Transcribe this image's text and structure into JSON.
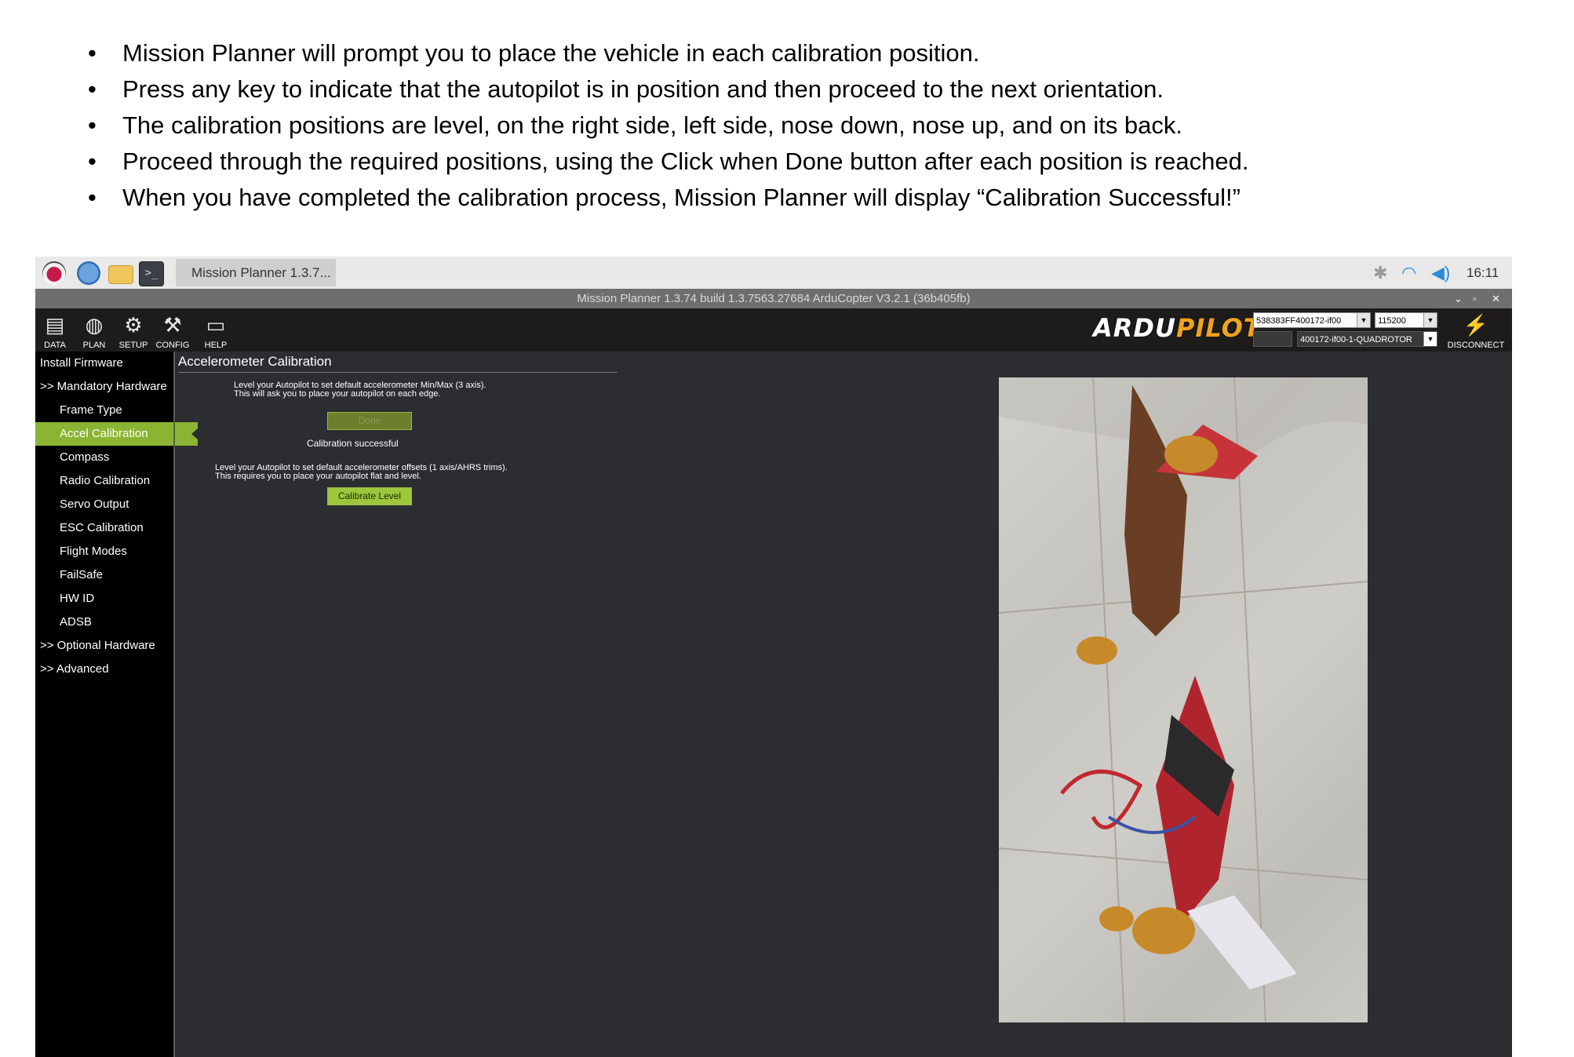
{
  "document": {
    "bullets": [
      "Mission Planner will prompt you to place the vehicle in each calibration position.",
      "Press any key to indicate that the autopilot is in position and then proceed to the next orientation.",
      "The calibration positions are level, on the right side, left side, nose down, nose up, and on its back.",
      "Proceed through the required positions, using the Click when Done button after each position is reached.",
      "When you have completed the calibration process, Mission Planner will display “Calibration Successful!”"
    ]
  },
  "taskbar": {
    "window_button": "Mission Planner 1.3.7...",
    "clock": "16:11",
    "icons": [
      "raspberry-icon",
      "globe-icon",
      "folder-icon",
      "terminal-icon",
      "bluetooth-icon",
      "wifi-icon",
      "volume-icon"
    ],
    "terminal_glyph": ">_"
  },
  "window": {
    "title": "Mission Planner 1.3.74 build 1.3.7563.27684 ArduCopter V3.2.1 (36b405fb)"
  },
  "toolbar": {
    "items": [
      {
        "label": "DATA",
        "icon": "data-icon"
      },
      {
        "label": "PLAN",
        "icon": "plan-icon"
      },
      {
        "label": "SETUP",
        "icon": "setup-icon"
      },
      {
        "label": "CONFIG",
        "icon": "config-icon"
      },
      {
        "label": "HELP",
        "icon": "help-icon"
      }
    ],
    "logo_ardu": "ARDU",
    "logo_pilot": "PILOT",
    "port_value": "538383FF400172-if00",
    "baud_value": "115200",
    "device_value": "400172-if00-1-QUADROTOR",
    "disconnect_label": "DISCONNECT"
  },
  "sidebar": {
    "items": [
      {
        "label": "Install Firmware",
        "level": 0
      },
      {
        "label": ">> Mandatory Hardware",
        "level": 0
      },
      {
        "label": "Frame Type",
        "level": 1
      },
      {
        "label": "Accel Calibration",
        "level": 1,
        "active": true
      },
      {
        "label": "Compass",
        "level": 1
      },
      {
        "label": "Radio Calibration",
        "level": 1
      },
      {
        "label": "Servo Output",
        "level": 1
      },
      {
        "label": "ESC Calibration",
        "level": 1
      },
      {
        "label": "Flight Modes",
        "level": 1
      },
      {
        "label": "FailSafe",
        "level": 1
      },
      {
        "label": "HW ID",
        "level": 1
      },
      {
        "label": "ADSB",
        "level": 1
      },
      {
        "label": ">> Optional Hardware",
        "level": 0
      },
      {
        "label": ">> Advanced",
        "level": 0
      }
    ]
  },
  "main": {
    "title": "Accelerometer Calibration",
    "accel_line1": "Level your Autopilot to set default accelerometer Min/Max (3 axis).",
    "accel_line2": "This will ask you to place your autopilot on each edge.",
    "done_button": "Done",
    "status": "Calibration successful",
    "level_line1": "Level your Autopilot to set default accelerometer offsets (1 axis/AHRS trims).",
    "level_line2": "This requires you to place your autopilot flat and level.",
    "calibrate_level_button": "Calibrate Level"
  },
  "colors": {
    "accent": "#8bb432",
    "background": "#2c2d30",
    "sidebar": "#000000",
    "logo_orange": "#f0a21c"
  }
}
